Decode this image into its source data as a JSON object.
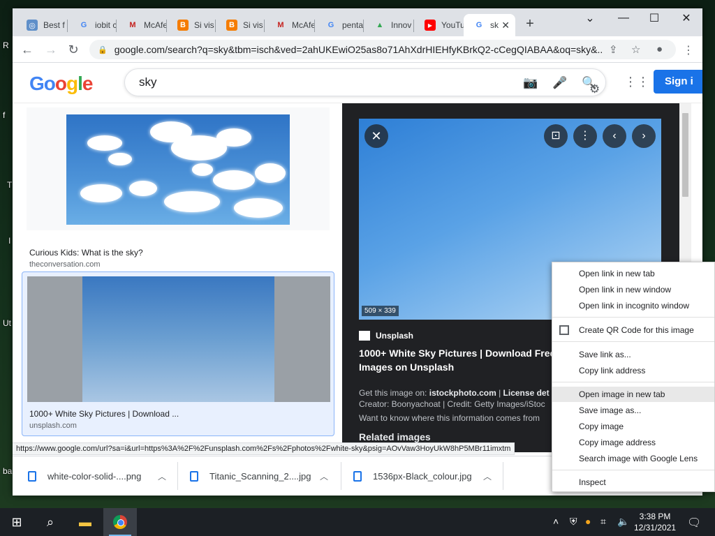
{
  "desktop": {
    "fragments": [
      "R",
      "f",
      "T",
      "I",
      "Ut",
      "ba"
    ]
  },
  "tabs": [
    {
      "title": "Best f",
      "icon": "globe-icon",
      "color": "#5f8fc9"
    },
    {
      "title": "iobit c",
      "icon": "google-icon",
      "color": "#4285f4"
    },
    {
      "title": "McAfe",
      "icon": "gmail-icon",
      "color": "#c5221f"
    },
    {
      "title": "Si vis",
      "icon": "blogger-icon",
      "color": "#f57c00"
    },
    {
      "title": "Si vis",
      "icon": "blogger-icon",
      "color": "#f57c00"
    },
    {
      "title": "McAfe",
      "icon": "gmail-icon",
      "color": "#c5221f"
    },
    {
      "title": "penta",
      "icon": "google-icon",
      "color": "#4285f4"
    },
    {
      "title": "Innov",
      "icon": "innov-icon",
      "color": "#34a853"
    },
    {
      "title": "YouTu",
      "icon": "youtube-icon",
      "color": "#ff0000"
    },
    {
      "title": "sk",
      "icon": "google-icon",
      "color": "#4285f4"
    }
  ],
  "address": {
    "url": "google.com/search?q=sky&tbm=isch&ved=2ahUKEwiO25as8o71AhXdrHIEHfyKBrkQ2-cCegQIABAA&oq=sky&..."
  },
  "google": {
    "logo": "Google",
    "query": "sky",
    "signin": "Sign i"
  },
  "results": [
    {
      "title": "Curious Kids: What is the sky?",
      "source": "theconversation.com"
    },
    {
      "title": "1000+ White Sky Pictures | Download ...",
      "source": "unsplash.com"
    }
  ],
  "preview": {
    "dimensions": "509 × 339",
    "source": "Unsplash",
    "title": "1000+ White Sky Pictures | Download Free Images on Unsplash",
    "get_label": "Get this image on:",
    "get_site": "istockphoto.com",
    "license_label": "License det",
    "creator": "Creator: Boonyachoat | Credit: Getty Images/iStoc",
    "info": "Want to know where this information comes from",
    "related": "Related images"
  },
  "status_url": "https://www.google.com/url?sa=i&url=https%3A%2F%2Funsplash.com%2Fs%2Fphotos%2Fwhite-sky&psig=AOvVaw3HoyUkW8hP5MBr11imxtm",
  "downloads": [
    {
      "name": "white-color-solid-....png"
    },
    {
      "name": "Titanic_Scanning_2....jpg"
    },
    {
      "name": "1536px-Black_colour.jpg"
    }
  ],
  "context_menu": [
    {
      "label": "Open link in new tab"
    },
    {
      "label": "Open link in new window"
    },
    {
      "label": "Open link in incognito window"
    },
    {
      "label": "Create QR Code for this image"
    },
    {
      "label": "Save link as..."
    },
    {
      "label": "Copy link address"
    },
    {
      "label": "Open image in new tab",
      "highlighted": true
    },
    {
      "label": "Save image as..."
    },
    {
      "label": "Copy image"
    },
    {
      "label": "Copy image address"
    },
    {
      "label": "Search image with Google Lens"
    },
    {
      "label": "Inspect"
    }
  ],
  "taskbar": {
    "time": "3:38 PM",
    "date": "12/31/2021"
  }
}
